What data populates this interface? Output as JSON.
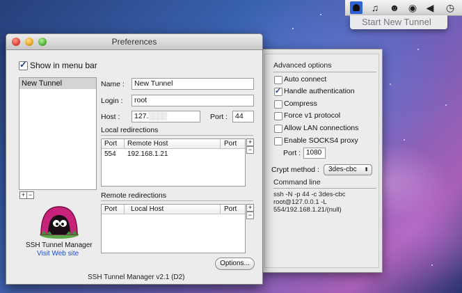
{
  "menubar": {
    "icons": [
      "tunnel-icon",
      "music-note-icon",
      "alien-icon",
      "network-icon",
      "speaker-icon",
      "time-machine-icon"
    ],
    "accent_color": "#2f63d6",
    "dropdown_item": "Start New Tunnel"
  },
  "window": {
    "title": "Preferences",
    "show_in_menu_bar_label": "Show in menu bar",
    "show_in_menu_bar_checked": true,
    "tunnel_list": [
      "New Tunnel"
    ],
    "list_add": "+",
    "list_remove": "−",
    "form": {
      "name_label": "Name :",
      "name_value": "New Tunnel",
      "login_label": "Login :",
      "login_value": "root",
      "host_label": "Host :",
      "host_value": "127.",
      "port_label": "Port :",
      "port_value": "44"
    },
    "local_redirections": {
      "title": "Local redirections",
      "columns": [
        "Port",
        "Remote Host",
        "Port"
      ],
      "rows": [
        [
          "554",
          "192.168.1.21",
          ""
        ]
      ]
    },
    "remote_redirections": {
      "title": "Remote redirections",
      "columns": [
        "Port",
        "Local Host",
        "Port"
      ],
      "rows": []
    },
    "table_add": "+",
    "table_remove": "−",
    "app_name": "SSH Tunnel Manager",
    "visit_link": "Visit Web site",
    "options_button": "Options...",
    "footer": "SSH Tunnel Manager v2.1 (D2)"
  },
  "drawer": {
    "advanced_title": "Advanced options",
    "options": [
      {
        "label": "Auto connect",
        "checked": false
      },
      {
        "label": "Handle authentication",
        "checked": true
      },
      {
        "label": "Compress",
        "checked": false
      },
      {
        "label": "Force v1 protocol",
        "checked": false
      },
      {
        "label": "Allow LAN connections",
        "checked": false
      },
      {
        "label": "Enable SOCKS4 proxy",
        "checked": false
      }
    ],
    "proxy_port_label": "Port :",
    "proxy_port_value": "1080",
    "crypt_label": "Crypt method :",
    "crypt_value": "3des-cbc",
    "command_title": "Command line",
    "command_lines": [
      "ssh -N -p 44 -c 3des-cbc",
      "root@127.0.0.1 -L",
      "554/192.168.1.21/(null)"
    ]
  }
}
